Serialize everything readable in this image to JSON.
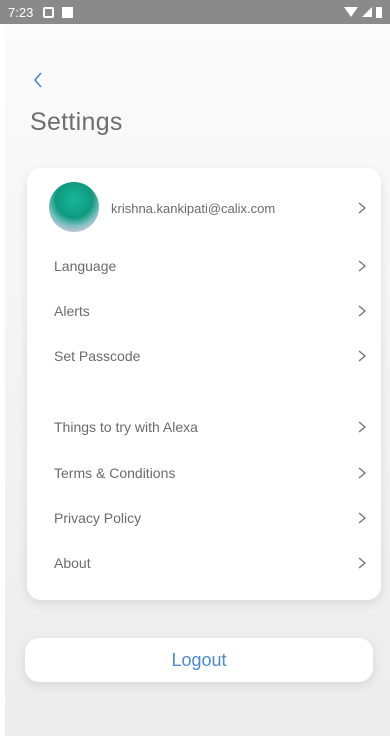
{
  "status_bar": {
    "time": "7:23",
    "left_icons": [
      "home-icon",
      "square-notification-icon"
    ],
    "right_icons": [
      "wifi-icon",
      "signal-icon",
      "battery-icon"
    ]
  },
  "header": {
    "back_icon": "chevron-left-icon",
    "title": "Settings"
  },
  "profile": {
    "email": "krishna.kankipati@calix.com",
    "avatar": "avatar-gradient"
  },
  "settings_items": [
    {
      "label": "Language"
    },
    {
      "label": "Alerts"
    },
    {
      "label": "Set Passcode"
    },
    {
      "label": "Things to try with Alexa"
    },
    {
      "label": "Terms & Conditions"
    },
    {
      "label": "Privacy Policy"
    },
    {
      "label": "About"
    }
  ],
  "logout": {
    "label": "Logout"
  },
  "colors": {
    "accent": "#4a8ad0",
    "text": "#6b6b6b",
    "status_bar": "#8a8a8a",
    "chevron": "#777777"
  }
}
